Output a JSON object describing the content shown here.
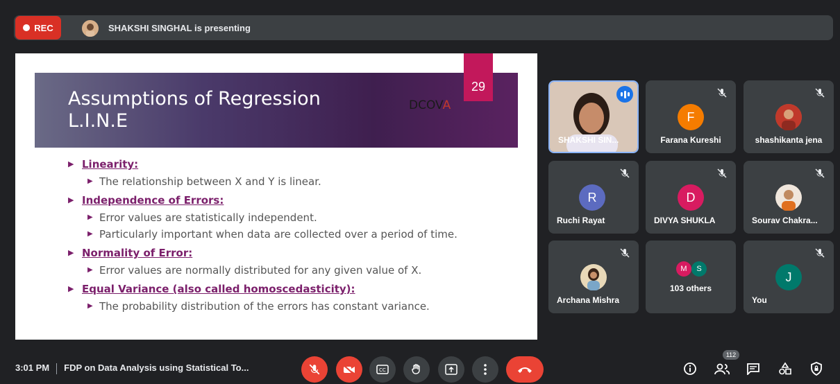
{
  "top_bar": {
    "rec_label": "REC",
    "presenting_text": "SHAKSHI SINGHAL is presenting"
  },
  "slide": {
    "page_number": "29",
    "title_line1": "Assumptions of Regression",
    "title_line2": "L.I.N.E",
    "logo_text": "DCOV",
    "logo_accent": "A",
    "items": [
      {
        "heading": "Linearity:",
        "points": [
          "The relationship between X and Y is linear."
        ]
      },
      {
        "heading": "Independence of Errors:",
        "points": [
          "Error values are statistically independent.",
          "Particularly important when data are collected over a period of time."
        ]
      },
      {
        "heading": "Normality of Error:",
        "points": [
          "Error values are normally distributed for any given value of X."
        ]
      },
      {
        "heading": "Equal Variance (also called homoscedasticity):",
        "points": [
          "The probability distribution of the errors has constant variance."
        ]
      }
    ]
  },
  "participants": [
    {
      "name": "SHAKSHI SIN...",
      "initial": "",
      "color": ""
    },
    {
      "name": "Farana Kureshi",
      "initial": "F",
      "color": "#f57c00"
    },
    {
      "name": "shashikanta jena",
      "initial": "",
      "color": ""
    },
    {
      "name": "Ruchi Rayat",
      "initial": "R",
      "color": "#5c6bc0"
    },
    {
      "name": "DIVYA SHUKLA",
      "initial": "D",
      "color": "#d81b60"
    },
    {
      "name": "Sourav Chakra...",
      "initial": "",
      "color": ""
    },
    {
      "name": "Archana Mishra",
      "initial": "",
      "color": ""
    },
    {
      "name": "103 others",
      "initial_a": "M",
      "initial_b": "S",
      "color_a": "#d81b60",
      "color_b": "#00796b"
    },
    {
      "name": "You",
      "initial": "J",
      "color": "#00796b"
    }
  ],
  "bottom_bar": {
    "time": "3:01 PM",
    "meeting_title": "FDP on Data Analysis using Statistical To...",
    "people_count": "112"
  },
  "colors": {
    "background": "#202124",
    "tile": "#3c4043",
    "danger": "#ea4335",
    "accent": "#1a73e8"
  }
}
